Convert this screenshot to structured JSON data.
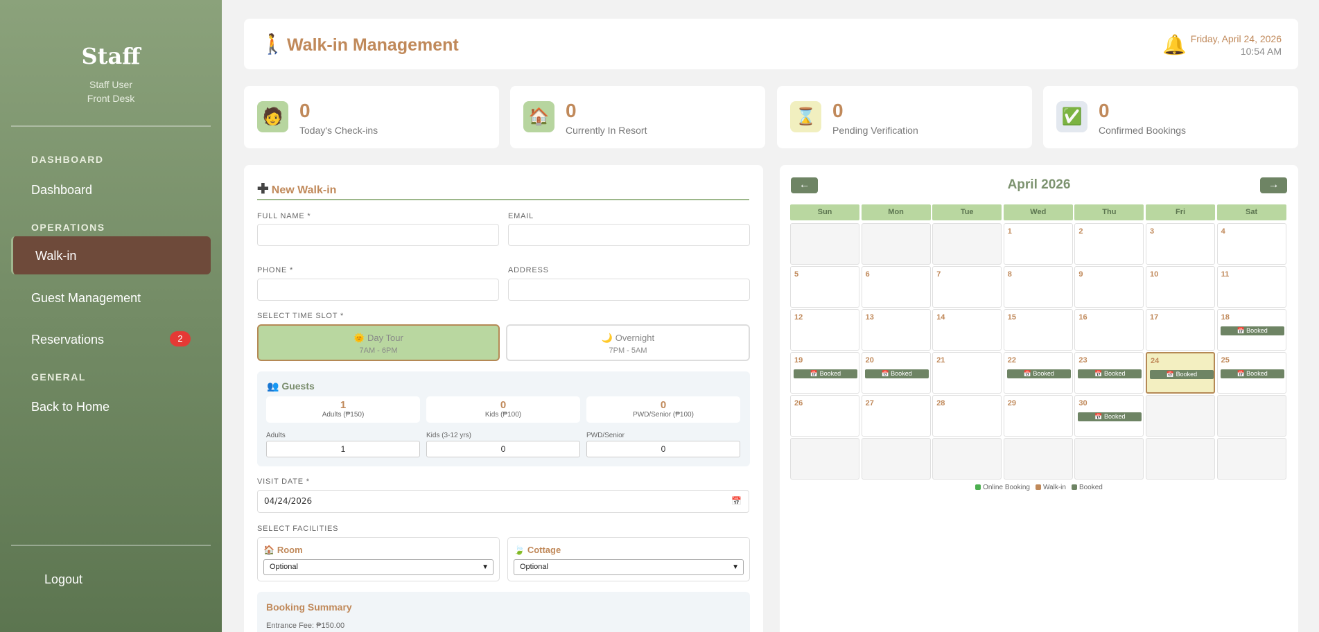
{
  "sidebar": {
    "brand": "Staff",
    "user_name": "Staff User",
    "user_role": "Front Desk",
    "sections": {
      "dashboard": "DASHBOARD",
      "operations": "OPERATIONS",
      "general": "GENERAL"
    },
    "items": {
      "dashboard": "Dashboard",
      "walkin": "Walk-in",
      "guest_management": "Guest Management",
      "reservations": "Reservations",
      "reservations_badge": "2",
      "back_home": "Back to Home",
      "logout": "Logout"
    }
  },
  "header": {
    "title": "Walk-in Management",
    "date": "Friday, April 24, 2026",
    "time": "10:54 AM"
  },
  "stats": [
    {
      "value": "0",
      "label": "Today's Check-ins",
      "icon": "person-icon"
    },
    {
      "value": "0",
      "label": "Currently In Resort",
      "icon": "house-icon"
    },
    {
      "value": "0",
      "label": "Pending Verification",
      "icon": "hourglass-icon"
    },
    {
      "value": "0",
      "label": "Confirmed Bookings",
      "icon": "check-icon"
    }
  ],
  "form": {
    "title": "New Walk-in",
    "full_name_label": "FULL NAME *",
    "email_label": "EMAIL",
    "phone_label": "PHONE *",
    "address_label": "ADDRESS",
    "time_slot_label": "SELECT TIME SLOT *",
    "slots": [
      {
        "label": "Day Tour",
        "time": "7AM - 6PM",
        "selected": true
      },
      {
        "label": "Overnight",
        "time": "7PM - 5AM",
        "selected": false
      }
    ],
    "guests": {
      "title": "Guests",
      "summary": [
        {
          "count": "1",
          "label": "Adults (₱150)"
        },
        {
          "count": "0",
          "label": "Kids (₱100)"
        },
        {
          "count": "0",
          "label": "PWD/Senior (₱100)"
        }
      ],
      "inputs": [
        {
          "label": "Adults",
          "value": "1"
        },
        {
          "label": "Kids (3-12 yrs)",
          "value": "0"
        },
        {
          "label": "PWD/Senior",
          "value": "0"
        }
      ]
    },
    "visit_date_label": "VISIT DATE *",
    "visit_date_value": "04/24/2026",
    "facilities_label": "SELECT FACILITIES",
    "room_label": "Room",
    "room_value": "Optional",
    "cottage_label": "Cottage",
    "cottage_value": "Optional",
    "summary_title": "Booking Summary",
    "entrance_fee": "Entrance Fee: ₱150.00"
  },
  "calendar": {
    "month": "April 2026",
    "prev": "←",
    "next": "→",
    "weekdays": [
      "Sun",
      "Mon",
      "Tue",
      "Wed",
      "Thu",
      "Fri",
      "Sat"
    ],
    "first_weekday": 3,
    "days_in_month": 30,
    "today": 24,
    "booked_days": [
      18,
      19,
      20,
      22,
      23,
      24,
      25,
      30
    ],
    "booked_label": "📅 Booked",
    "legend": [
      {
        "label": "Online Booking",
        "color": "#4caf50"
      },
      {
        "label": "Walk-in",
        "color": "#c0895a"
      },
      {
        "label": "Booked",
        "color": "#6e8464"
      }
    ]
  }
}
